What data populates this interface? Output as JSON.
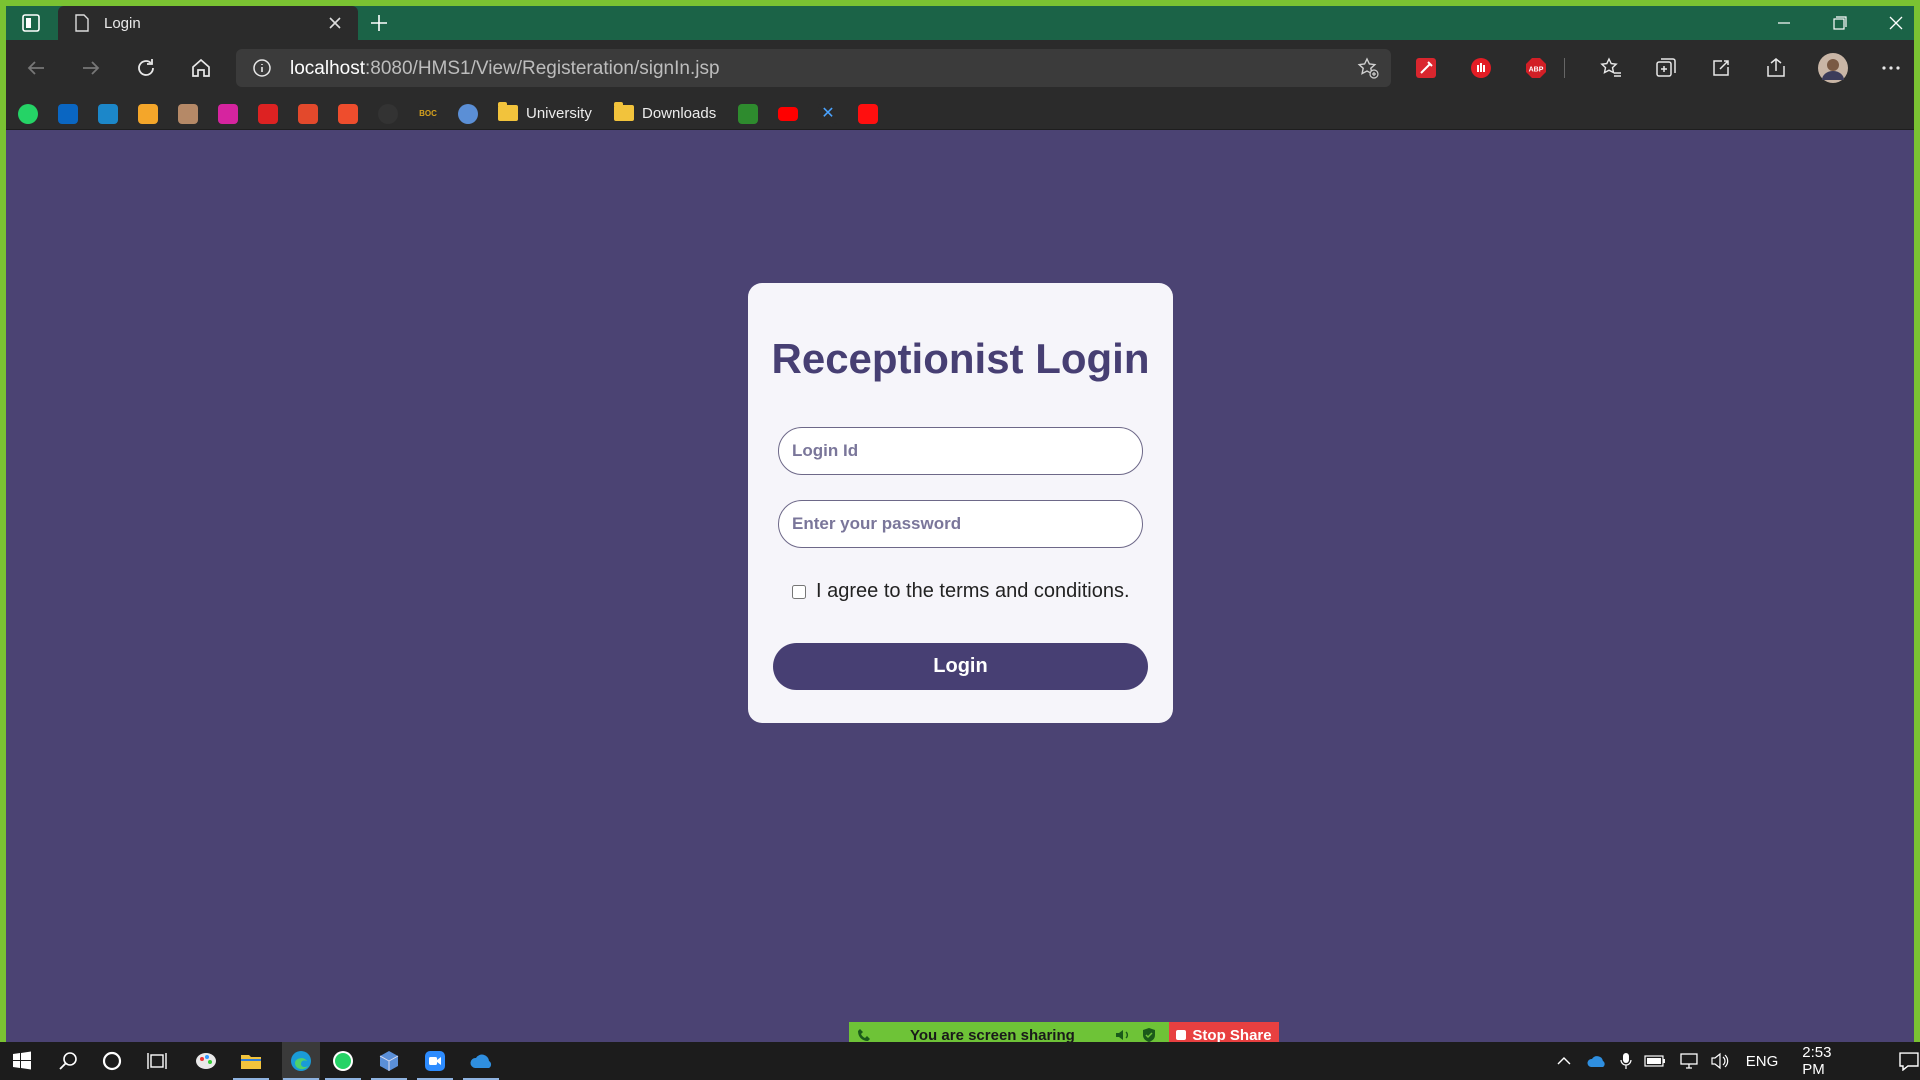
{
  "browser": {
    "tab_title": "Login",
    "url_host": "localhost",
    "url_rest": ":8080/HMS1/View/Registeration/signIn.jsp",
    "bookmarks_folders": [
      "University",
      "Downloads"
    ]
  },
  "login": {
    "title": "Receptionist Login",
    "login_id_placeholder": "Login Id",
    "password_placeholder": "Enter your password",
    "terms_label": "I agree to the terms and conditions.",
    "button_label": "Login"
  },
  "share_bar": {
    "status": "You are screen sharing",
    "stop_label": "Stop Share"
  },
  "taskbar": {
    "language": "ENG",
    "time": "2:53 PM"
  },
  "colors": {
    "page_bg": "#4b4373",
    "accent": "#473f73",
    "card_bg": "#f6f5fa",
    "share_green": "#6ec337",
    "share_red": "#e84040"
  }
}
